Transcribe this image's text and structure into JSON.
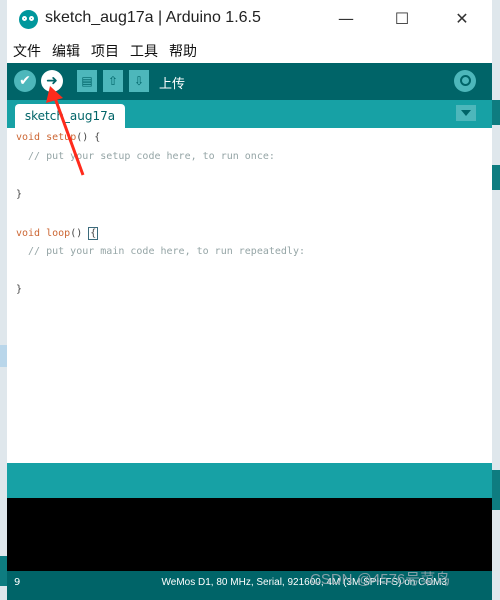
{
  "window": {
    "title": "sketch_aug17a | Arduino 1.6.5",
    "controls": {
      "minimize": "—",
      "maximize": "☐",
      "close": "✕"
    }
  },
  "menu": [
    "文件",
    "编辑",
    "项目",
    "工具",
    "帮助"
  ],
  "toolbar": {
    "verify_icon": "✔",
    "upload_icon": "➜",
    "new_icon": "▤",
    "open_icon": "⇧",
    "save_icon": "⇩",
    "hover_label": "上传"
  },
  "tab": {
    "name": "sketch_aug17a"
  },
  "code": [
    {
      "type": "setup-sig",
      "kw": "void",
      "fn": "setup",
      "rest": "() {"
    },
    {
      "type": "comment",
      "text": "  // put your setup code here, to run once:"
    },
    {
      "type": "blank",
      "text": ""
    },
    {
      "type": "plain",
      "text": "}"
    },
    {
      "type": "blank",
      "text": ""
    },
    {
      "type": "loop-sig",
      "kw": "void",
      "fn": "loop",
      "rest": "() ",
      "brace": "{"
    },
    {
      "type": "comment",
      "text": "  // put your main code here, to run repeatedly:"
    },
    {
      "type": "blank",
      "text": ""
    },
    {
      "type": "plain",
      "text": "}"
    }
  ],
  "status": {
    "line_number": "9",
    "board": "WeMos D1, 80 MHz, Serial, 921600, 4M (3M SPIFFS) on COM3"
  },
  "watermark": "CSDN @4576号菜鸟",
  "colors": {
    "toolbar": "#006468",
    "tabbar": "#17a1a5",
    "button": "#4db7bb",
    "keyword": "#cc6633",
    "comment": "#95a5a6",
    "annotation": "#ff2b1c"
  }
}
